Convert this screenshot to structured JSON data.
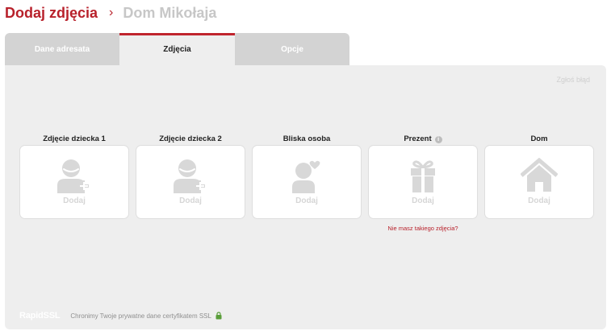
{
  "header": {
    "title": "Dodaj zdjęcia",
    "separator": "›",
    "subtitle": "Dom Mikołaja"
  },
  "tabs": [
    {
      "label": "Dane adresata",
      "active": false
    },
    {
      "label": "Zdjęcia",
      "active": true
    },
    {
      "label": "Opcje",
      "active": false
    }
  ],
  "panel": {
    "report_link": "Zgłoś błąd",
    "slots": [
      {
        "label": "Zdjęcie dziecka 1",
        "icon": "add-person-icon",
        "add_label": "Dodaj"
      },
      {
        "label": "Zdjęcie dziecka 2",
        "icon": "add-person-icon",
        "add_label": "Dodaj"
      },
      {
        "label": "Bliska osoba",
        "icon": "person-heart-icon",
        "add_label": "Dodaj"
      },
      {
        "label": "Prezent",
        "icon": "gift-icon",
        "add_label": "Dodaj",
        "info_icon": "info-icon",
        "info_glyph": "i",
        "note": "Nie masz takiego zdjęcia?"
      },
      {
        "label": "Dom",
        "icon": "house-icon",
        "add_label": "Dodaj"
      }
    ]
  },
  "footer": {
    "badge": "RapidSSL",
    "ssl_text": "Chronimy Twoje prywatne dane certyfikatem SSL",
    "lock_icon": "lock-icon"
  },
  "colors": {
    "accent": "#b8212b",
    "panel_bg": "#eeeeee",
    "tab_inactive": "#d3d3d3",
    "icon_gray": "#d8d8d8",
    "lock_green": "#5a9e3a"
  }
}
